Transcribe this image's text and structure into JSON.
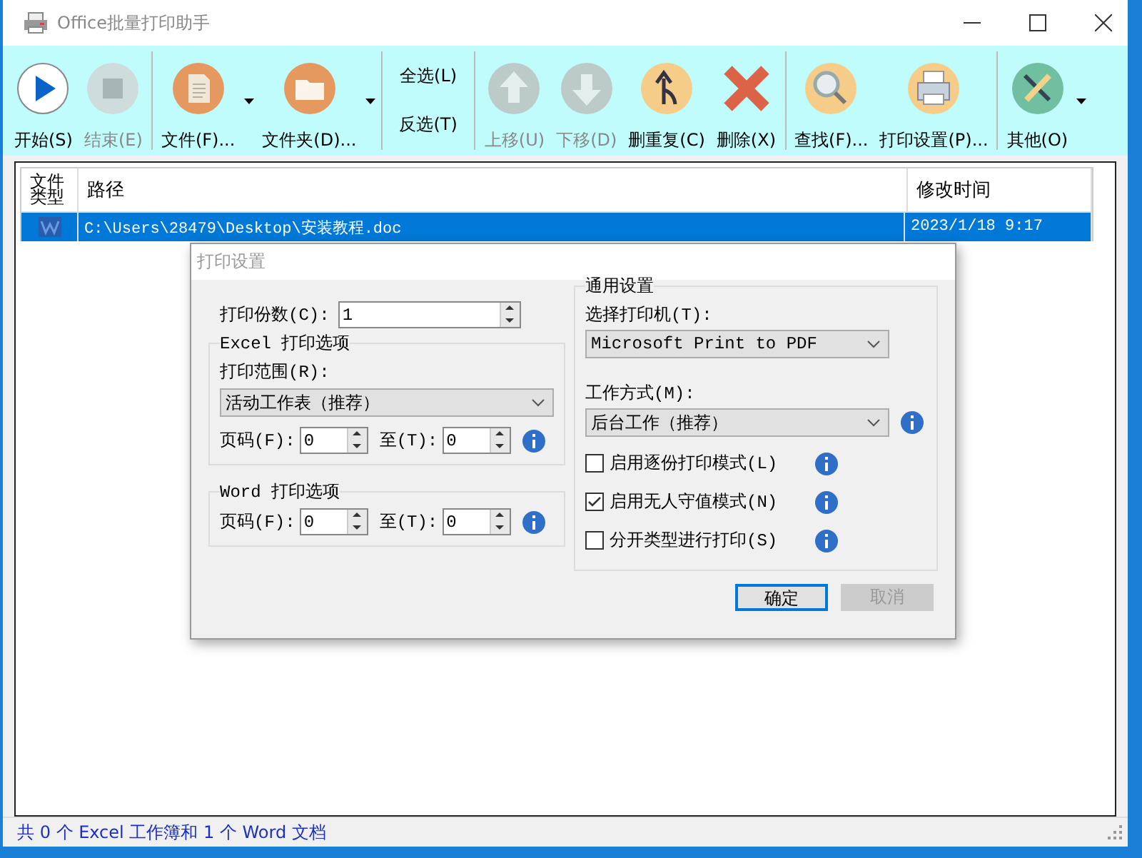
{
  "window": {
    "title": "Office批量打印助手"
  },
  "toolbar": {
    "groups": [
      [
        {
          "kind": "button",
          "label": "开始(S)",
          "disabled": false,
          "menu": false
        },
        {
          "kind": "button",
          "label": "结束(E)",
          "disabled": true,
          "menu": false
        }
      ],
      [
        {
          "kind": "button",
          "label": "文件(F)...",
          "disabled": false,
          "menu": true
        },
        {
          "kind": "button",
          "label": "文件夹(D)...",
          "disabled": false,
          "menu": true
        }
      ],
      [
        {
          "kind": "text",
          "label": "全选(L)"
        },
        {
          "kind": "text",
          "label": "反选(T)"
        }
      ],
      [
        {
          "kind": "button",
          "label": "上移(U)",
          "disabled": true,
          "menu": false
        },
        {
          "kind": "button",
          "label": "下移(D)",
          "disabled": true,
          "menu": false
        },
        {
          "kind": "button",
          "label": "删重复(C)",
          "disabled": false,
          "menu": false
        },
        {
          "kind": "button",
          "label": "删除(X)",
          "disabled": false,
          "menu": false
        }
      ],
      [
        {
          "kind": "button",
          "label": "查找(F)...",
          "disabled": false,
          "menu": false
        },
        {
          "kind": "button",
          "label": "打印设置(P)...",
          "disabled": false,
          "menu": false
        }
      ],
      [
        {
          "kind": "button",
          "label": "其他(O)",
          "disabled": false,
          "menu": true
        }
      ]
    ]
  },
  "table": {
    "columns": [
      "文件类型",
      "路径",
      "修改时间"
    ],
    "rows": [
      {
        "selected": true,
        "path": "C:\\Users\\28479\\Desktop\\安装教程.doc",
        "modified": "2023/1/18 9:17"
      }
    ]
  },
  "dialog": {
    "title": "打印设置",
    "copies": {
      "label": "打印份数(C):",
      "value": "1"
    },
    "excel": {
      "legend": "Excel 打印选项",
      "range_label": "打印范围(R):",
      "range_value": "活动工作表（推荐）",
      "from_label": "页码(F):",
      "from_value": "0",
      "to_label": "至(T):",
      "to_value": "0"
    },
    "word": {
      "legend": "Word 打印选项",
      "from_label": "页码(F):",
      "from_value": "0",
      "to_label": "至(T):",
      "to_value": "0"
    },
    "general": {
      "legend": "通用设置",
      "printer_label": "选择打印机(T):",
      "printer_value": "Microsoft Print to PDF",
      "mode_label": "工作方式(M):",
      "mode_value": "后台工作（推荐）",
      "options": [
        {
          "label": "启用逐份打印模式(L)",
          "checked": false
        },
        {
          "label": "启用无人守值模式(N)",
          "checked": true
        },
        {
          "label": "分开类型进行打印(S)",
          "checked": false
        }
      ]
    },
    "buttons": [
      {
        "label": "确定",
        "disabled": false
      },
      {
        "label": "取消",
        "disabled": true
      }
    ]
  },
  "status_bar": "共 0 个 Excel 工作簿和 1 个 Word 文档"
}
